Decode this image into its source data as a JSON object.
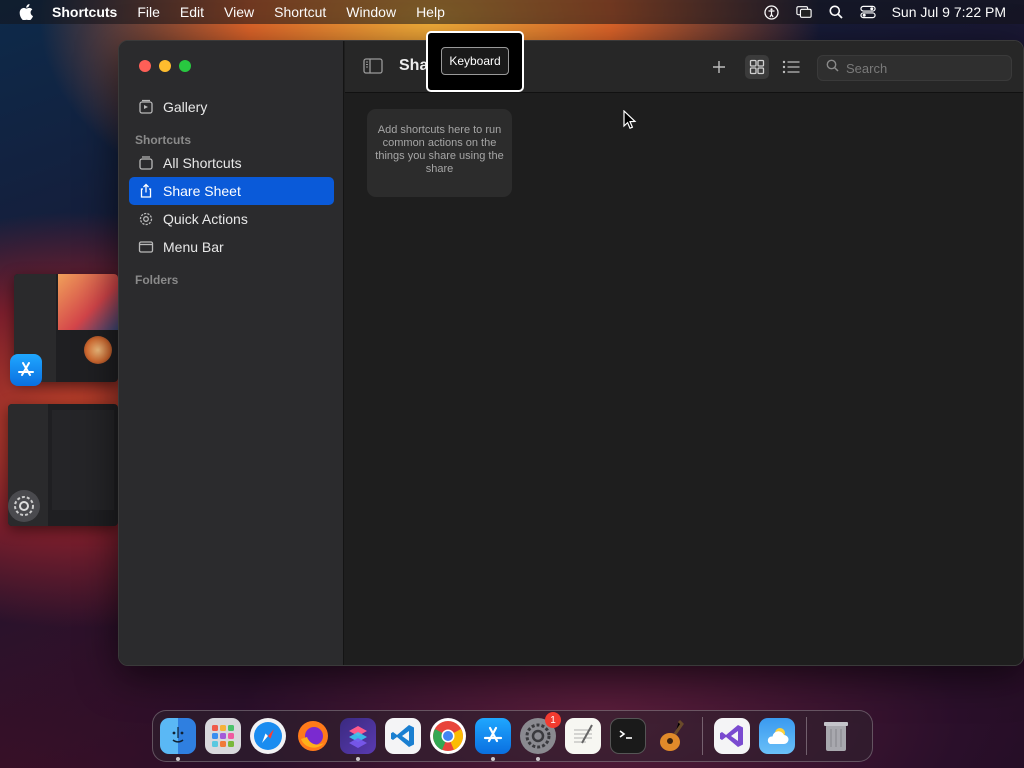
{
  "menubar": {
    "app_name": "Shortcuts",
    "menus": [
      "File",
      "Edit",
      "View",
      "Shortcut",
      "Window",
      "Help"
    ],
    "clock": "Sun Jul 9  7:22 PM",
    "status_icons": [
      "accessibility-icon",
      "screen-mirroring-icon",
      "spotlight-search-icon",
      "control-center-icon"
    ]
  },
  "sidebar": {
    "gallery_label": "Gallery",
    "shortcuts_section": "Shortcuts",
    "items": [
      {
        "label": "All Shortcuts",
        "icon": "all-shortcuts-icon"
      },
      {
        "label": "Share Sheet",
        "icon": "share-icon",
        "selected": true
      },
      {
        "label": "Quick Actions",
        "icon": "gear-icon"
      },
      {
        "label": "Menu Bar",
        "icon": "menu-bar-icon"
      }
    ],
    "folders_section": "Folders"
  },
  "toolbar": {
    "title": "Sha",
    "search_placeholder": "Search"
  },
  "main": {
    "empty_message": "Add shortcuts here to run common actions on the things you share using the share"
  },
  "tooltip": {
    "label": "Keyboard"
  },
  "dock": {
    "apps": [
      {
        "name": "Finder",
        "icon": "finder-icon",
        "running": true
      },
      {
        "name": "Launchpad",
        "icon": "launchpad-icon"
      },
      {
        "name": "Safari",
        "icon": "safari-icon"
      },
      {
        "name": "Firefox",
        "icon": "firefox-icon"
      },
      {
        "name": "Shortcuts",
        "icon": "shortcuts-icon",
        "running": true
      },
      {
        "name": "Visual Studio Code",
        "icon": "vscode-icon"
      },
      {
        "name": "Chrome",
        "icon": "chrome-icon"
      },
      {
        "name": "App Store",
        "icon": "app-store-icon",
        "running": true
      },
      {
        "name": "System Settings",
        "icon": "settings-icon",
        "running": true,
        "badge": "1"
      },
      {
        "name": "TextEdit",
        "icon": "textedit-icon"
      },
      {
        "name": "Terminal",
        "icon": "terminal-icon"
      },
      {
        "name": "GarageBand",
        "icon": "garageband-icon"
      },
      {
        "name": "Visual Studio",
        "icon": "visual-studio-icon"
      },
      {
        "name": "Weather",
        "icon": "weather-icon"
      },
      {
        "name": "Trash",
        "icon": "trash-icon"
      }
    ]
  },
  "colors": {
    "accent": "#0a5ad9",
    "sidebar_bg": "#2b2b2d",
    "window_bg": "#1e1e1e"
  }
}
